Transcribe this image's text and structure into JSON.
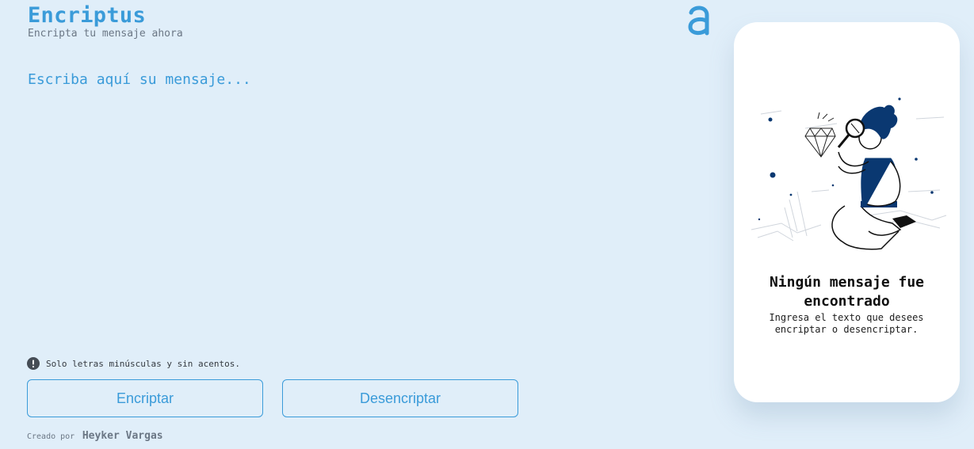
{
  "app": {
    "title": "Encriptus",
    "subtitle": "Encripta tu mensaje ahora",
    "logo_icon": "alura-logo-icon"
  },
  "input": {
    "placeholder": "Escriba aquí su mensaje...",
    "value": ""
  },
  "hint": {
    "icon": "exclamation-circle-icon",
    "text": "Solo letras minúsculas y sin acentos."
  },
  "buttons": {
    "encrypt_label": "Encriptar",
    "decrypt_label": "Desencriptar"
  },
  "footer": {
    "credit_label": "Creado por",
    "author": "Heyker Vargas"
  },
  "output": {
    "illustration": "person-with-magnifying-glass-illustration",
    "empty_title": "Ningún mensaje fue encontrado",
    "empty_description": "Ingresa el texto que desees encriptar o desencriptar."
  },
  "colors": {
    "background": "#e0eef9",
    "accent": "#3a9bd9",
    "panel": "#ffffff",
    "illustration_navy": "#0a3871"
  }
}
